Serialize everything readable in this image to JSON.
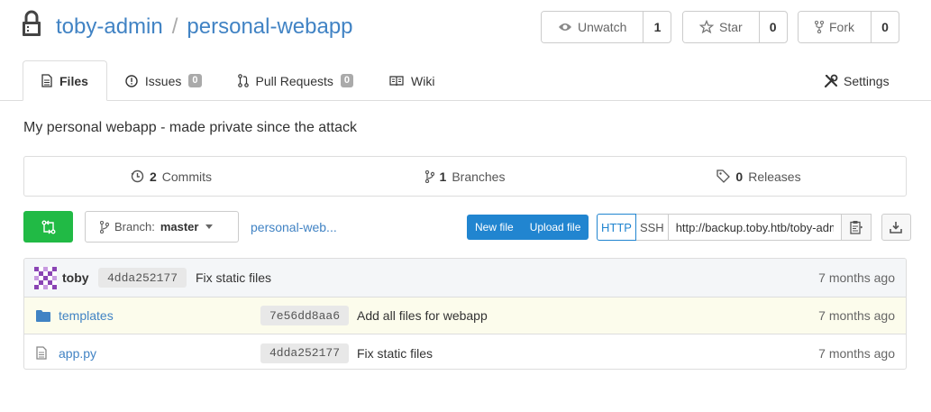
{
  "header": {
    "owner": "toby-admin",
    "separator": "/",
    "repo": "personal-webapp",
    "watch": {
      "label": "Unwatch",
      "count": "1"
    },
    "star": {
      "label": "Star",
      "count": "0"
    },
    "fork": {
      "label": "Fork",
      "count": "0"
    }
  },
  "tabs": [
    {
      "label": "Files",
      "icon": "file-icon",
      "active": true
    },
    {
      "label": "Issues",
      "badge": "0",
      "icon": "issue-icon"
    },
    {
      "label": "Pull Requests",
      "badge": "0",
      "icon": "pull-request-icon"
    },
    {
      "label": "Wiki",
      "icon": "book-icon"
    }
  ],
  "settings": {
    "label": "Settings",
    "icon": "tools-icon"
  },
  "description": "My personal webapp - made private since the attack",
  "stats": {
    "commits": {
      "count": "2",
      "label": "Commits"
    },
    "branches": {
      "count": "1",
      "label": "Branches"
    },
    "releases": {
      "count": "0",
      "label": "Releases"
    }
  },
  "toolbar": {
    "branch_label": "Branch:",
    "branch_name": "master",
    "breadcrumb": "personal-web...",
    "new_file": "New file",
    "upload_file": "Upload file",
    "http": "HTTP",
    "ssh": "SSH",
    "clone_url": "http://backup.toby.htb/toby-admin/personal-webapp.git"
  },
  "latest_commit": {
    "author": "toby",
    "sha": "4dda252177",
    "message": "Fix static files",
    "time": "7 months ago"
  },
  "files": [
    {
      "type": "folder",
      "name": "templates",
      "sha": "7e56dd8aa6",
      "message": "Add all files for webapp",
      "time": "7 months ago"
    },
    {
      "type": "file",
      "name": "app.py",
      "sha": "4dda252177",
      "message": "Fix static files",
      "time": "7 months ago"
    }
  ],
  "colors": {
    "link": "#4183c4",
    "green": "#21ba45",
    "blue": "#2185d0",
    "highlight_row": "#fcfcec"
  }
}
